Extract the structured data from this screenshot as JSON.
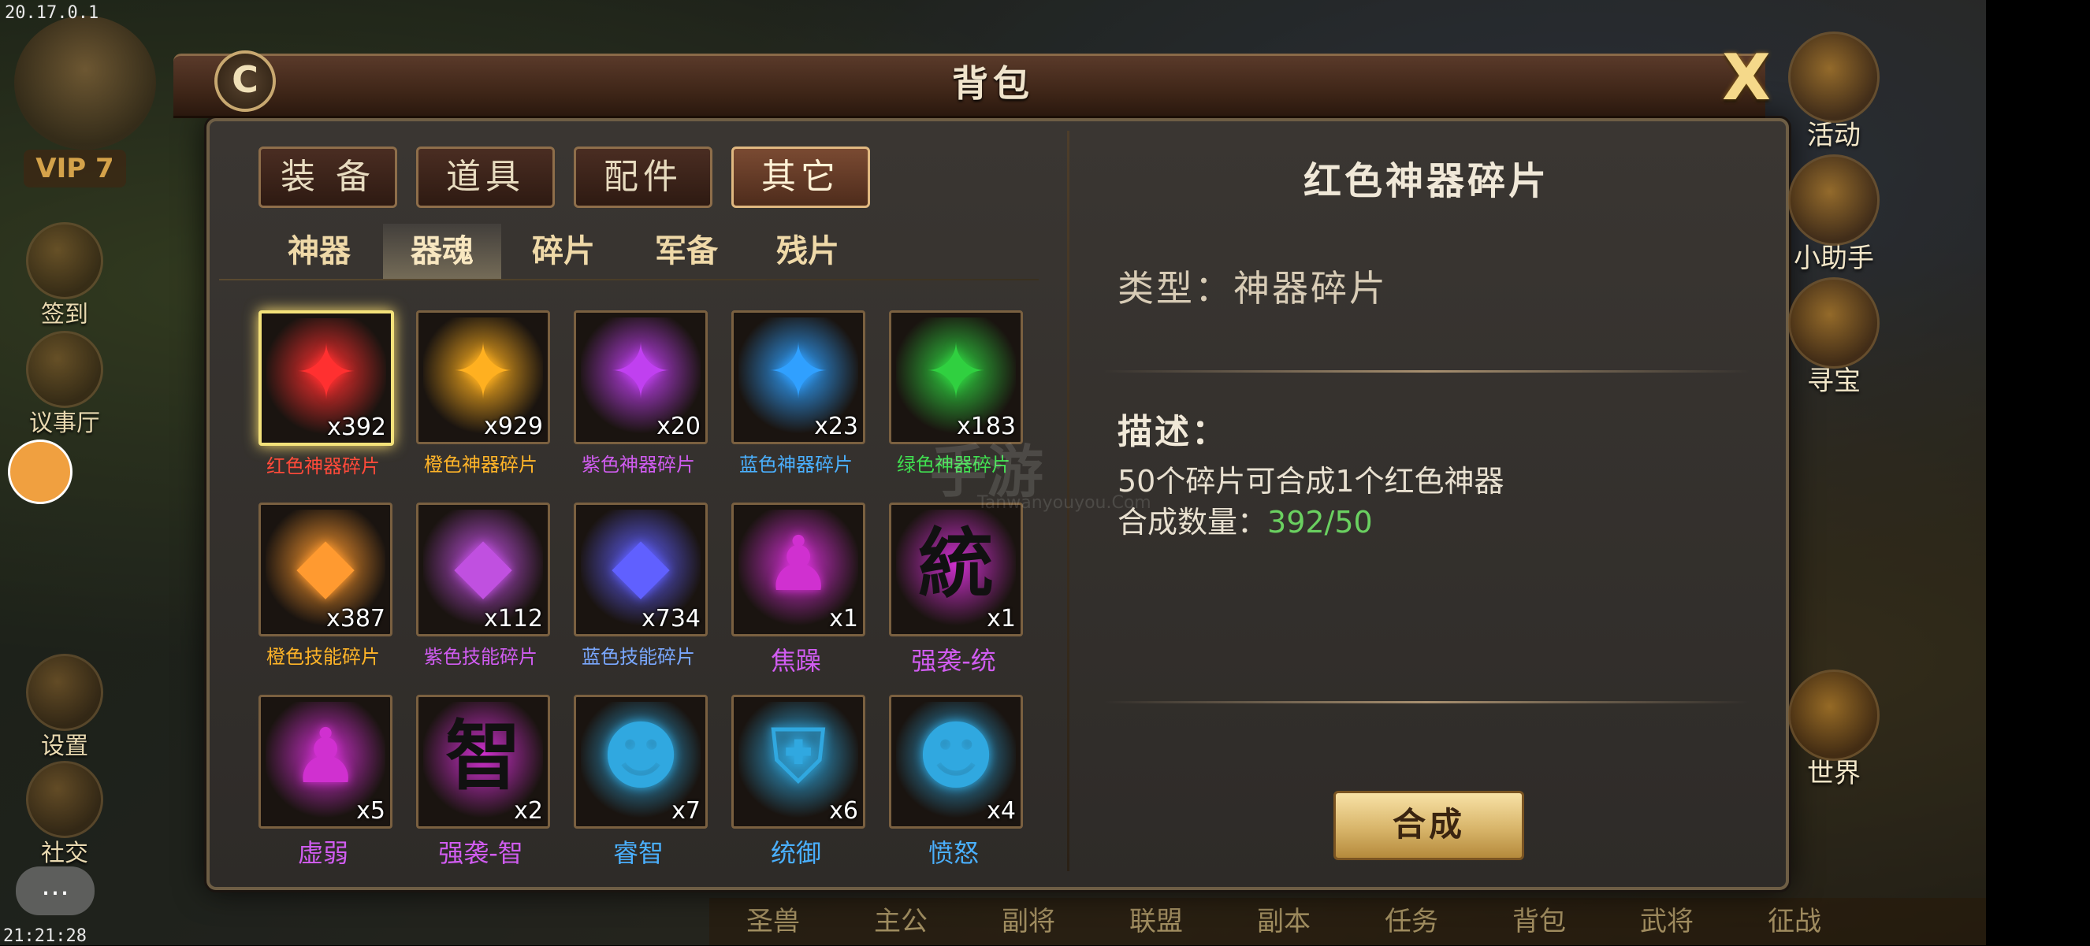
{
  "system": {
    "version": "20.17.0.1",
    "clock": "21:21:28"
  },
  "player": {
    "vip": "VIP 7"
  },
  "left_menu": [
    {
      "label": "签到",
      "icon": "checkin-icon"
    },
    {
      "label": "议事厅",
      "icon": "council-hall-icon"
    },
    {
      "label": "设置",
      "icon": "gear-icon"
    },
    {
      "label": "社交",
      "icon": "social-icon"
    }
  ],
  "right_menu": [
    {
      "label": "活动",
      "icon": "gift-box-icon"
    },
    {
      "label": "小助手",
      "icon": "scroll-icon"
    },
    {
      "label": "寻宝",
      "icon": "treasure-chest-icon"
    },
    {
      "label": "世界",
      "icon": "world-dragon-icon"
    }
  ],
  "bottom_menu": [
    "圣兽",
    "主公",
    "副将",
    "联盟",
    "副本",
    "任务",
    "背包",
    "武将",
    "征战"
  ],
  "panel": {
    "title": "背包",
    "close_symbol": "X",
    "refresh_symbol": "C"
  },
  "category_tabs": [
    {
      "label": "装 备",
      "active": false
    },
    {
      "label": "道具",
      "active": false
    },
    {
      "label": "配件",
      "active": false
    },
    {
      "label": "其它",
      "active": true
    }
  ],
  "sub_tabs": [
    {
      "label": "神器",
      "active": false
    },
    {
      "label": "器魂",
      "active": true
    },
    {
      "label": "碎片",
      "active": false
    },
    {
      "label": "军备",
      "active": false
    },
    {
      "label": "残片",
      "active": false
    }
  ],
  "items": [
    {
      "name": "红色神器碎片",
      "qty": "x392",
      "color": "#ff3030",
      "name_color": "#ff4a3a",
      "glyph": "puzzle-piece",
      "selected": true
    },
    {
      "name": "橙色神器碎片",
      "qty": "x929",
      "color": "#ffb020",
      "name_color": "#ffb428",
      "glyph": "puzzle-piece",
      "selected": false
    },
    {
      "name": "紫色神器碎片",
      "qty": "x20",
      "color": "#c040f0",
      "name_color": "#d05cf0",
      "glyph": "puzzle-piece",
      "selected": false
    },
    {
      "name": "蓝色神器碎片",
      "qty": "x23",
      "color": "#30a0ff",
      "name_color": "#4ab0ff",
      "glyph": "puzzle-piece",
      "selected": false
    },
    {
      "name": "绿色神器碎片",
      "qty": "x183",
      "color": "#30d040",
      "name_color": "#40e050",
      "glyph": "puzzle-piece",
      "selected": false
    },
    {
      "name": "橙色技能碎片",
      "qty": "x387",
      "color": "#ff9a30",
      "name_color": "#ffb428",
      "glyph": "crystal",
      "selected": false
    },
    {
      "name": "紫色技能碎片",
      "qty": "x112",
      "color": "#c050e0",
      "name_color": "#d05cf0",
      "glyph": "crystal",
      "selected": false
    },
    {
      "name": "蓝色技能碎片",
      "qty": "x734",
      "color": "#6060ff",
      "name_color": "#7aa8ff",
      "glyph": "crystal",
      "selected": false
    },
    {
      "name": "焦躁",
      "qty": "x1",
      "color": "#d030d0",
      "name_color": "#d05cf0",
      "glyph": "figure",
      "selected": false
    },
    {
      "name": "强袭-统",
      "qty": "x1",
      "color": "#d030d0",
      "name_color": "#d05cf0",
      "glyph": "統",
      "selected": false
    },
    {
      "name": "虚弱",
      "qty": "x5",
      "color": "#d030d0",
      "name_color": "#d05cf0",
      "glyph": "figure",
      "selected": false
    },
    {
      "name": "强袭-智",
      "qty": "x2",
      "color": "#d030d0",
      "name_color": "#d05cf0",
      "glyph": "智",
      "selected": false
    },
    {
      "name": "睿智",
      "qty": "x7",
      "color": "#30a8e0",
      "name_color": "#4ab0ff",
      "glyph": "face",
      "selected": false
    },
    {
      "name": "统御",
      "qty": "x6",
      "color": "#30a8e0",
      "name_color": "#4ab0ff",
      "glyph": "shield",
      "selected": false
    },
    {
      "name": "愤怒",
      "qty": "x4",
      "color": "#30a8e0",
      "name_color": "#4ab0ff",
      "glyph": "face",
      "selected": false
    }
  ],
  "detail": {
    "title": "红色神器碎片",
    "type_line": "类型：神器碎片",
    "desc_label": "描述：",
    "desc_text": "50个碎片可合成1个红色神器",
    "count_label": "合成数量：",
    "count_value": "392/50",
    "compose_button": "合成"
  },
  "watermark": {
    "main": "手游",
    "sub": "Tanwanyouyou.Com"
  }
}
